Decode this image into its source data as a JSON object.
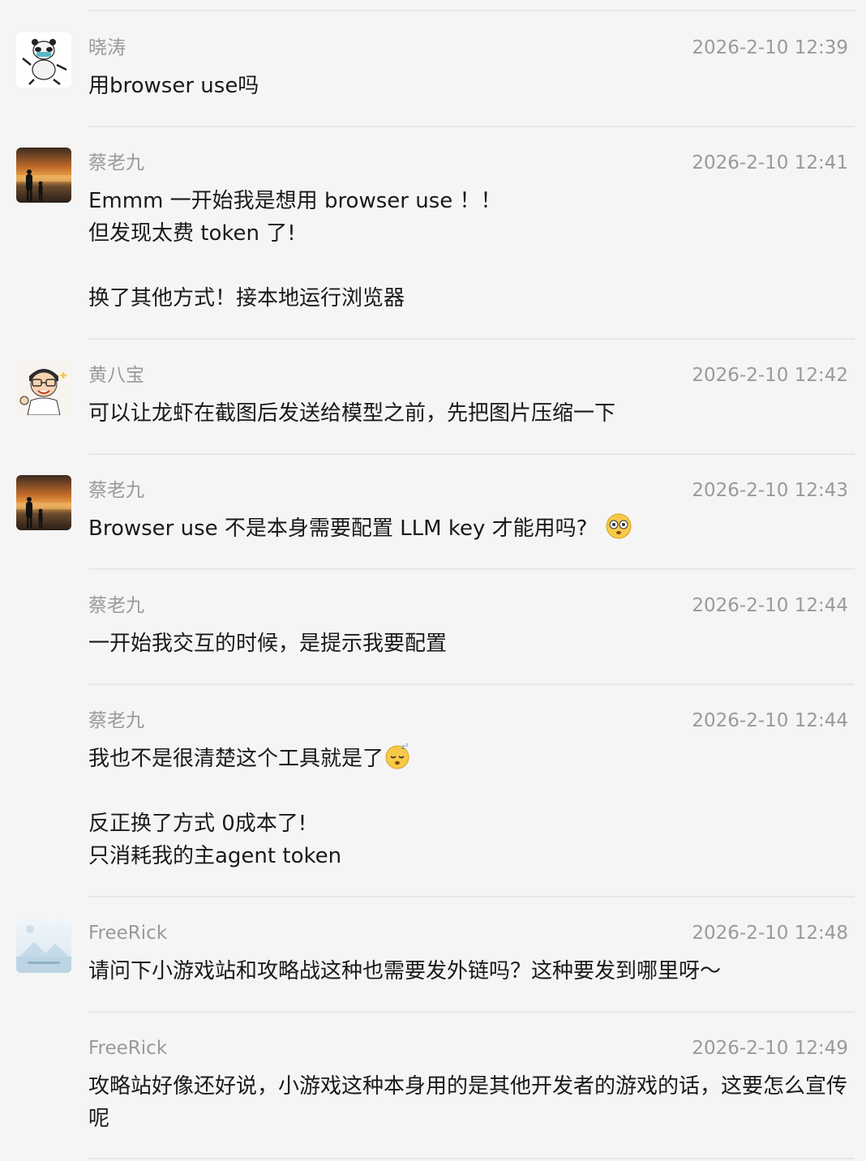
{
  "messages": [
    {
      "sender": "晓涛",
      "time": "2026-2-10 12:39",
      "avatar": "panda-avatar",
      "text": "用browser use吗"
    },
    {
      "sender": "蔡老九",
      "time": "2026-2-10 12:41",
      "avatar": "sunset-silhouette-avatar",
      "text": "Emmm 一开始我是想用 browser use ！！\n但发现太费 token 了!\n\n换了其他方式！接本地运行浏览器"
    },
    {
      "sender": "黄八宝",
      "time": "2026-2-10 12:42",
      "avatar": "cartoon-man-avatar",
      "text": "可以让龙虾在截图后发送给模型之前，先把图片压缩一下"
    },
    {
      "sender": "蔡老九",
      "time": "2026-2-10 12:43",
      "avatar": "sunset-silhouette-avatar",
      "text": "Browser use 不是本身需要配置 LLM key 才能用吗?",
      "emoji": "flushed-face-emoji"
    },
    {
      "sender": "蔡老九",
      "time": "2026-2-10 12:44",
      "avatar": "",
      "text": "一开始我交互的时候，是提示我要配置"
    },
    {
      "sender": "蔡老九",
      "time": "2026-2-10 12:44",
      "avatar": "",
      "text_part1": "我也不是很清楚这个工具就是了",
      "emoji": "sleeping-face-emoji",
      "text_part2": "反正换了方式  0成本了!\n只消耗我的主agent token"
    },
    {
      "sender": "FreeRick",
      "time": "2026-2-10 12:48",
      "avatar": "landscape-placeholder-avatar",
      "text": "请问下小游戏站和攻略战这种也需要发外链吗？这种要发到哪里呀～"
    },
    {
      "sender": "FreeRick",
      "time": "2026-2-10 12:49",
      "avatar": "",
      "text": "攻略站好像还好说，小游戏这种本身用的是其他开发者的游戏的话，这要怎么宣传呢"
    }
  ]
}
